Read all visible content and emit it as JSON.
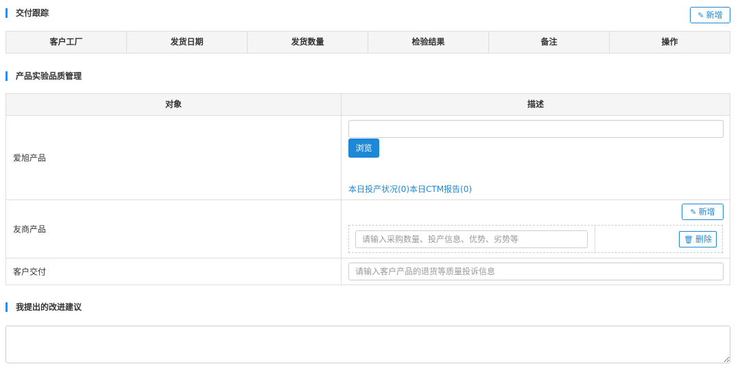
{
  "delivery": {
    "title": "交付跟踪",
    "add_button": "新增",
    "columns": [
      "客户工厂",
      "发货日期",
      "发货数量",
      "检验结果",
      "备注",
      "操作"
    ]
  },
  "quality": {
    "title": "产品实验品质管理",
    "header": {
      "object": "对象",
      "description": "描述"
    },
    "rows": {
      "aixu": {
        "label": "爱旭产品",
        "browse_button": "浏览",
        "link": "本日投产状况(0)本日CTM报告(0)"
      },
      "competitor": {
        "label": "友商产品",
        "add_button": "新增",
        "input_placeholder": "请输入采购数量、投产信息、优势、劣势等",
        "delete_button": "删除"
      },
      "customer": {
        "label": "客户交付",
        "input_placeholder": "请输入客户产品的退货等质量投诉信息"
      }
    }
  },
  "suggestions": {
    "title": "我提出的改进建议",
    "value": ""
  },
  "colors": {
    "accent": "#1e88d6",
    "section_bar": "#2d8cf0",
    "header_bg": "#f5f5f5"
  },
  "icons": {
    "edit": "edit-icon",
    "trash": "trash-icon"
  }
}
